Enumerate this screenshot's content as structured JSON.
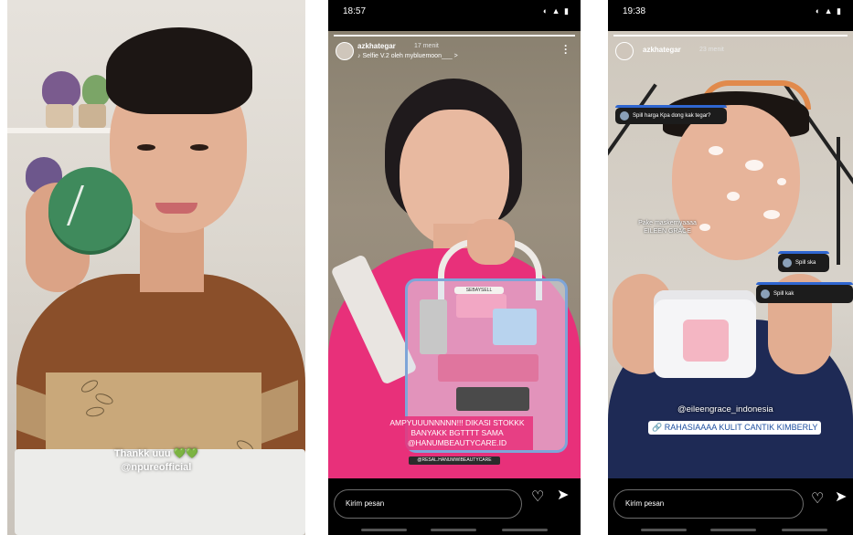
{
  "panel1": {
    "caption_line1": "Thankk uuu",
    "caption_hearts": "💚💚",
    "caption_line2": "@npureofficial"
  },
  "panel2": {
    "status_time": "18:57",
    "status_icons": "◐ ▲ ▮",
    "username": "azkhategar",
    "time_ago": "17 menit",
    "music": "♪ Selfie V.2 oleh mybluemoon___  >",
    "bag_label": "SEBAYSELL",
    "caption": "AMPYUUUNNNNN!!! DIKASI STOKKK BANYAKK BGTTTT SAMA @HANUMBEAUTYCARE.ID",
    "tag": "@RESAL.HANUMWIBEAUTYCARE",
    "reply_placeholder": "Kirim pesan"
  },
  "panel3": {
    "status_time": "19:38",
    "status_icons": "◐ ▲ ▮",
    "username": "azkhategar",
    "time_ago": "23 menit",
    "question1": "Spill harga Kpa dong kak tegar?",
    "note": "Pake maskernyaaaa EILEEN GRACE",
    "question2": "Spill ska",
    "question3": "Spill kak",
    "mention": "@eileengrace_indonesia",
    "link": "🔗 RAHASIAAAA KULIT CANTIK KIMBERLY",
    "reply_placeholder": "Kirim pesan"
  }
}
